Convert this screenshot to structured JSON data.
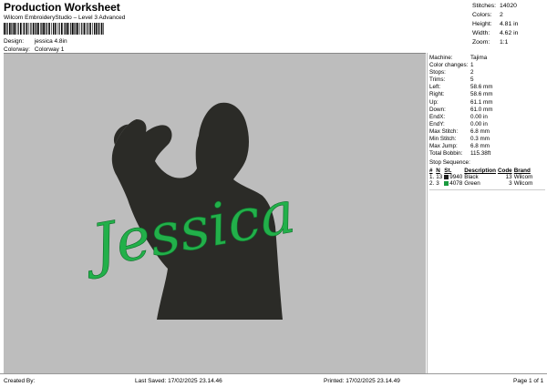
{
  "header": {
    "title": "Production Worksheet",
    "subtitle": "Wilcom EmbroideryStudio – Level 3 Advanced",
    "design_label": "Design:",
    "design_value": "jessica 4.8in",
    "colorway_label": "Colorway:",
    "colorway_value": "Colorway 1"
  },
  "summary": [
    {
      "label": "Stitches:",
      "value": "14020"
    },
    {
      "label": "Colors:",
      "value": "2"
    },
    {
      "label": "Height:",
      "value": "4.81 in"
    },
    {
      "label": "Width:",
      "value": "4.62 in"
    },
    {
      "label": "Zoom:",
      "value": "1:1"
    }
  ],
  "machine_info": [
    {
      "label": "Machine:",
      "value": "Tajima"
    },
    {
      "label": "Color changes:",
      "value": "1"
    },
    {
      "label": "Stops:",
      "value": "2"
    },
    {
      "label": "Trims:",
      "value": "5"
    },
    {
      "label": "Left:",
      "value": "58.6 mm"
    },
    {
      "label": "Right:",
      "value": "58.6 mm"
    },
    {
      "label": "Up:",
      "value": "61.1 mm"
    },
    {
      "label": "Down:",
      "value": "61.0 mm"
    },
    {
      "label": "EndX:",
      "value": "0.00 in"
    },
    {
      "label": "EndY:",
      "value": "0.00 in"
    },
    {
      "label": "Max Stitch:",
      "value": "6.8 mm"
    },
    {
      "label": "Min Stitch:",
      "value": "0.3 mm"
    },
    {
      "label": "Max Jump:",
      "value": "6.8 mm"
    },
    {
      "label": "Total Bobbin:",
      "value": "115.38ft"
    }
  ],
  "stop_sequence": {
    "title": "Stop Sequence:",
    "columns": [
      "#",
      "N",
      "St.",
      "Description",
      "Code",
      "Brand"
    ],
    "rows": [
      {
        "idx": "1.",
        "n": "13",
        "st": "9940",
        "description": "Black",
        "code": "13",
        "brand": "Wilcom",
        "color": "#1f1f1f"
      },
      {
        "idx": "2.",
        "n": "3",
        "st": "4078",
        "description": "Green",
        "code": "3",
        "brand": "Wilcom",
        "color": "#1a9a3f"
      }
    ]
  },
  "design_art": {
    "text": "Jessica",
    "silhouette_color": "#2b2b27",
    "text_color": "#22b04a",
    "background_color": "#bdbdbd"
  },
  "footer": {
    "created_by": "Created By:",
    "last_saved": "Last Saved: 17/02/2025 23.14.46",
    "printed": "Printed: 17/02/2025 23.14.49",
    "page": "Page 1 of 1"
  }
}
